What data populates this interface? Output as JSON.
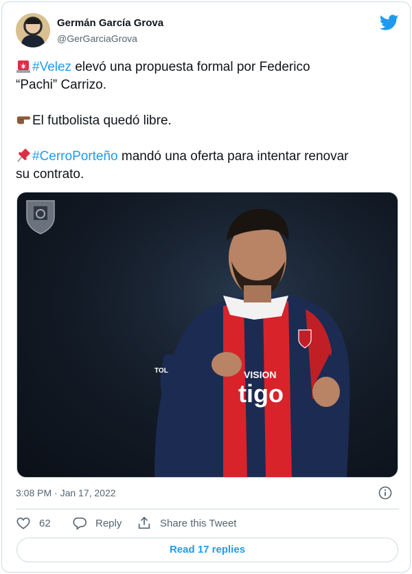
{
  "author": {
    "name": "Germán García Grova",
    "handle": "@GerGarciaGrova"
  },
  "icons": {
    "brand": "twitter-bird-icon",
    "info": "info-icon",
    "like": "heart-icon",
    "reply": "reply-bubble-icon",
    "share": "share-upload-icon"
  },
  "tweet": {
    "line1": {
      "emoji": "siren-emoji",
      "hashtag": "#Velez",
      "text": " elevó una propuesta formal por Federico",
      "cont": "“Pachi” Carrizo."
    },
    "line2": {
      "emoji": "pointing-right-emoji",
      "text": "El futbolista quedó libre."
    },
    "line3": {
      "emoji": "pushpin-emoji",
      "hashtag": "#CerroPorteño",
      "text": " mandó una oferta para intentar renovar",
      "cont": "su contrato."
    }
  },
  "media": {
    "jersey_sponsor_top": "VISION",
    "jersey_sponsor_main": "tigo",
    "jersey_sleeve_text": "TOL"
  },
  "timestamp": "3:08 PM · Jan 17, 2022",
  "actions": {
    "like_count": "62",
    "reply_label": "Reply",
    "share_label": "Share this Tweet"
  },
  "read_replies_label": "Read 17 replies",
  "colors": {
    "accent": "#1d9bf0",
    "text": "#0f1419",
    "secondary": "#536471",
    "border": "#cfd9de"
  }
}
